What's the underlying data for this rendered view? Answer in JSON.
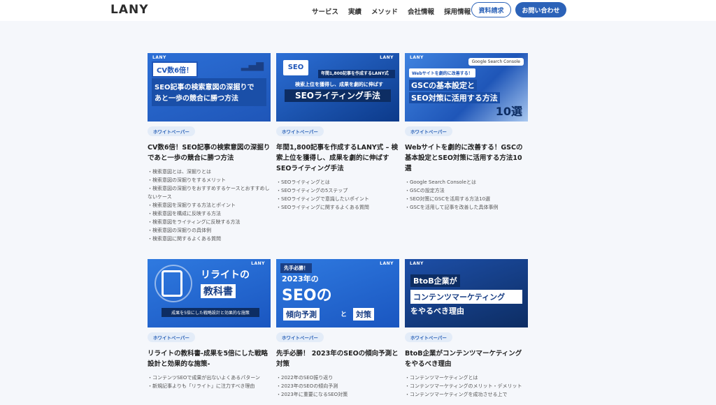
{
  "header": {
    "logo": "LANY",
    "nav": [
      "サービス",
      "実績",
      "メソッド",
      "会社情報",
      "採用情報"
    ],
    "request_button": "資料請求",
    "contact_button": "お問い合わせ"
  },
  "cards": [
    {
      "thumb": {
        "brand": "LANY",
        "tag": "CV数6倍！",
        "line1": "SEO記事の検索意図の深掘りで",
        "line2": "あと一歩の競合に勝つ方法"
      },
      "badge": "ホワイトペーパー",
      "title": "CV数6倍！SEO記事の検索意図の深掘りであと一歩の競合に勝つ方法",
      "items": [
        "・検索意図とは、深掘りとは",
        "・検索意図の深掘りをするメリット",
        "・検索意図の深掘りをおすすめするケースとおすすめしないケース",
        "・検索意図を深掘りする方法とポイント",
        "・検索意図を構成に反映する方法",
        "・検索意図をライティングに反映する方法",
        "・検索意図の深掘りの具体例",
        "・検索意図に関するよくある質問"
      ]
    },
    {
      "thumb": {
        "brand": "LANY",
        "seo": "SEO",
        "top": "年間1,800記事を作成するLANY式",
        "mid": "検索上位を獲得し、成果を劇的に伸ばす",
        "big": "SEOライティング手法"
      },
      "badge": "ホワイトペーパー",
      "title": "年間1,800記事を作成するLANY式 – 検索上位を獲得し、成果を劇的に伸ばすSEOライティング手法",
      "items": [
        "・SEOライティングとは",
        "・SEOライティングの5ステップ",
        "・SEOライティングで意識したいポイント",
        "・SEOライティングに関するよくある質問"
      ]
    },
    {
      "thumb": {
        "brand": "LANY",
        "gsc": "Google Search Console",
        "small": "Webサイトを劇的に改善する！",
        "line1": "GSCの基本設定と",
        "line2": "SEO対策に活用する方法",
        "num": "10選"
      },
      "badge": "ホワイトペーパー",
      "title": "Webサイトを劇的に改善する！GSCの基本設定とSEO対策に活用する方法10選",
      "items": [
        "・Google Search Consoleとは",
        "・GSCの設定方法",
        "・SEO対策にGSCを活用する方法10選",
        "・GSCを活用して記事を改善した具体事例"
      ]
    },
    {
      "thumb": {
        "brand": "LANY",
        "line1": "リライトの",
        "line2": "教科書",
        "sub": "成果を5倍にした戦略設計と効果的な施策"
      },
      "badge": "ホワイトペーパー",
      "title": "リライトの教科書-成果を5倍にした戦略設計と効果的な施策-",
      "items": [
        "・コンテンツSEOで成果が出ないよくあるパターン",
        "・新規記事よりも「リライト」に注力すべき理由"
      ]
    },
    {
      "thumb": {
        "brand": "LANY",
        "tag": "先手必勝！",
        "line1": "2023年の",
        "seo": "SEOの",
        "box1": "傾向予測",
        "to": "と",
        "box2": "対策"
      },
      "badge": "ホワイトペーパー",
      "title": "先手必勝！ 2023年のSEOの傾向予測と対策",
      "items": [
        "・2022年のSEO振り返り",
        "・2023年のSEOの傾向予測",
        "・2023年に重要になるSEO対策"
      ]
    },
    {
      "thumb": {
        "brand": "LANY",
        "line1": "BtoB企業が",
        "line2": "コンテンツマーケティング",
        "line3": "をやるべき理由"
      },
      "badge": "ホワイトペーパー",
      "title": "BtoB企業がコンテンツマーケティングをやるべき理由",
      "items": [
        "・コンテンツマーケティングとは",
        "・コンテンツマーケティングのメリット・デメリット",
        "・コンテンツマーケティングを成功させる上で"
      ]
    }
  ]
}
